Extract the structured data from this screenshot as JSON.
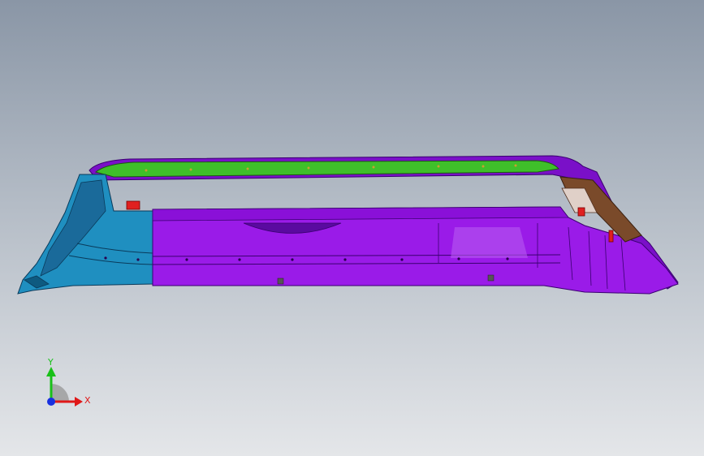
{
  "viewport": {
    "background_top": "#8a96a6",
    "background_bottom": "#e4e6e9"
  },
  "model": {
    "part_colors": {
      "blue_section": "#1f8fc0",
      "purple_section": "#9a1be8",
      "green_rail": "#3fbf2a",
      "brown_bracket": "#7a4a2a",
      "red_clip": "#e02020"
    }
  },
  "triad": {
    "x_label": "X",
    "y_label": "Y",
    "x_color": "#e01818",
    "y_color": "#18c018",
    "z_color": "#1830e0"
  }
}
